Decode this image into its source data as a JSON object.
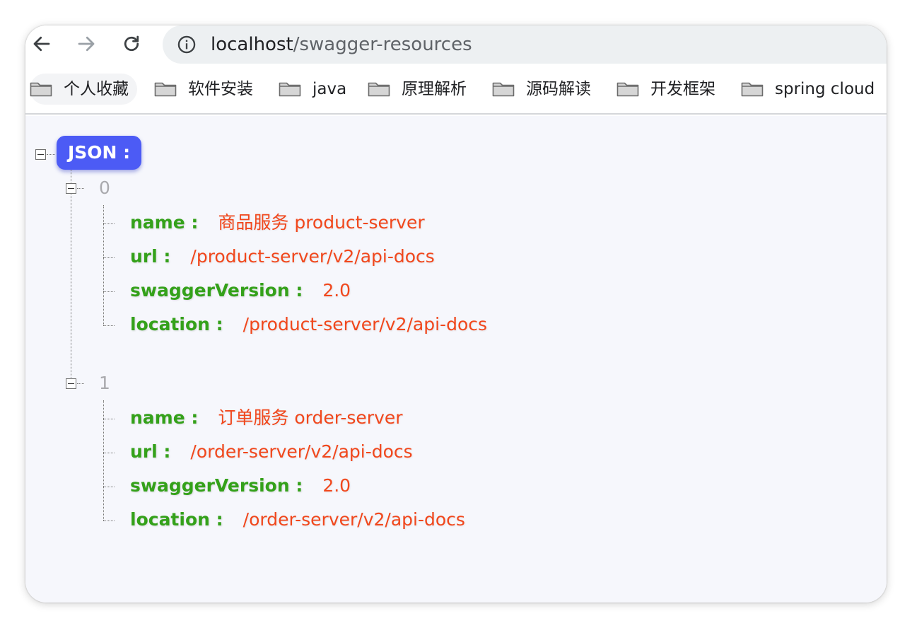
{
  "browser": {
    "url_host": "localhost",
    "url_path": "/swagger-resources"
  },
  "bookmarks": [
    {
      "label": "个人收藏",
      "icon": "folder-icon"
    },
    {
      "label": "软件安装",
      "icon": "folder-icon"
    },
    {
      "label": "java",
      "icon": "folder-icon"
    },
    {
      "label": "原理解析",
      "icon": "folder-icon"
    },
    {
      "label": "源码解读",
      "icon": "folder-icon"
    },
    {
      "label": "开发框架",
      "icon": "folder-icon"
    },
    {
      "label": "spring cloud",
      "icon": "folder-icon"
    }
  ],
  "json_viewer": {
    "root_label": "JSON :",
    "items": [
      {
        "index": "0",
        "fields": [
          {
            "key": "name :",
            "value": "商品服务 product-server"
          },
          {
            "key": "url :",
            "value": "/product-server/v2/api-docs"
          },
          {
            "key": "swaggerVersion :",
            "value": "2.0"
          },
          {
            "key": "location :",
            "value": "/product-server/v2/api-docs"
          }
        ]
      },
      {
        "index": "1",
        "fields": [
          {
            "key": "name :",
            "value": "订单服务 order-server"
          },
          {
            "key": "url :",
            "value": "/order-server/v2/api-docs"
          },
          {
            "key": "swaggerVersion :",
            "value": "2.0"
          },
          {
            "key": "location :",
            "value": "/order-server/v2/api-docs"
          }
        ]
      }
    ]
  },
  "colors": {
    "root_badge": "#4c5bf5",
    "key": "#34a11a",
    "value": "#f1471c",
    "index": "#a9a9ad"
  }
}
